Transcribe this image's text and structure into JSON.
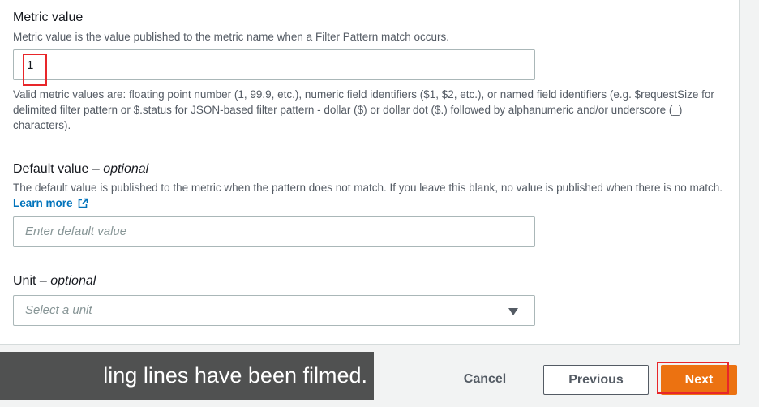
{
  "metric_value": {
    "label": "Metric value",
    "description": "Metric value is the value published to the metric name when a Filter Pattern match occurs.",
    "value": "1",
    "help_text": "Valid metric values are: floating point number (1, 99.9, etc.), numeric field identifiers ($1, $2, etc.), or named field identifiers (e.g. $requestSize for delimited filter pattern or $.status for JSON-based filter pattern - dollar ($) or dollar dot ($.) followed by alphanumeric and/or underscore (_) characters)."
  },
  "default_value": {
    "label": "Default value",
    "optional": "optional",
    "dash": " – ",
    "description": "The default value is published to the metric when the pattern does not match. If you leave this blank, no value is published when there is no match.",
    "learn_more": "Learn more",
    "placeholder": "Enter default value"
  },
  "unit": {
    "label": "Unit",
    "optional": "optional",
    "dash": " – ",
    "placeholder": "Select a unit"
  },
  "footer": {
    "cancel_label": "Cancel",
    "previous_label": "Previous",
    "next_label": "Next"
  },
  "subtitle": {
    "text": "ling lines have been filmed."
  },
  "colors": {
    "primary": "#ec7211",
    "link": "#0073bb",
    "highlight": "#e8262a"
  },
  "icons": {
    "external_link": "external-link-icon",
    "dropdown": "caret-down-icon"
  }
}
